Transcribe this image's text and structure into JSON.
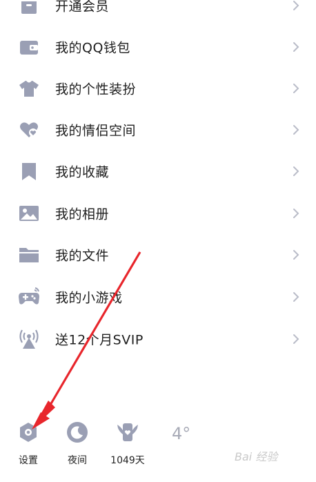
{
  "colors": {
    "icon": "#9a9fb4",
    "chevron": "#b9bcc8",
    "text": "#1e1e1e",
    "arrow": "#e8262c"
  },
  "menu": {
    "items": [
      {
        "label": "开通会员",
        "icon": "vip-icon"
      },
      {
        "label": "我的QQ钱包",
        "icon": "wallet-icon"
      },
      {
        "label": "我的个性装扮",
        "icon": "shirt-icon"
      },
      {
        "label": "我的情侣空间",
        "icon": "heart-icon"
      },
      {
        "label": "我的收藏",
        "icon": "bookmark-icon"
      },
      {
        "label": "我的相册",
        "icon": "photo-icon"
      },
      {
        "label": "我的文件",
        "icon": "folder-icon"
      },
      {
        "label": "我的小游戏",
        "icon": "gamepad-icon"
      },
      {
        "label": "送12个月SVIP",
        "icon": "broadcast-icon"
      }
    ]
  },
  "bottom_bar": {
    "settings_label": "设置",
    "night_label": "夜间",
    "days_label": "1049天",
    "weather_temp": "4°"
  },
  "watermark": "Bai 经验"
}
